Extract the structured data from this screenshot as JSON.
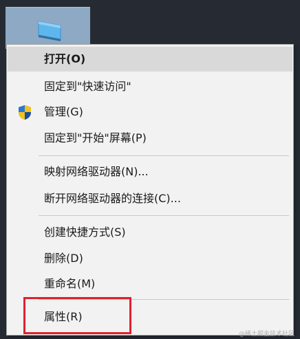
{
  "colors": {
    "desktop_bg": "#262b33",
    "menu_bg": "#f2f2f2",
    "highlight_bg": "#d9d9d9",
    "callout_border": "#e0212b"
  },
  "desktop_icon": {
    "icon": "network-drive-icon"
  },
  "menu": {
    "items": [
      {
        "label": "打开(O)",
        "bold": true,
        "highlighted": true
      },
      {
        "label": "固定到\"快速访问\""
      },
      {
        "label": "管理(G)",
        "icon": "uac-shield-icon"
      },
      {
        "label": "固定到\"开始\"屏幕(P)"
      },
      {
        "label": "映射网络驱动器(N)..."
      },
      {
        "label": "断开网络驱动器的连接(C)..."
      },
      {
        "label": "创建快捷方式(S)"
      },
      {
        "label": "删除(D)"
      },
      {
        "label": "重命名(M)"
      },
      {
        "label": "属性(R)"
      }
    ]
  },
  "watermark": "@稀土掘金技术社区"
}
